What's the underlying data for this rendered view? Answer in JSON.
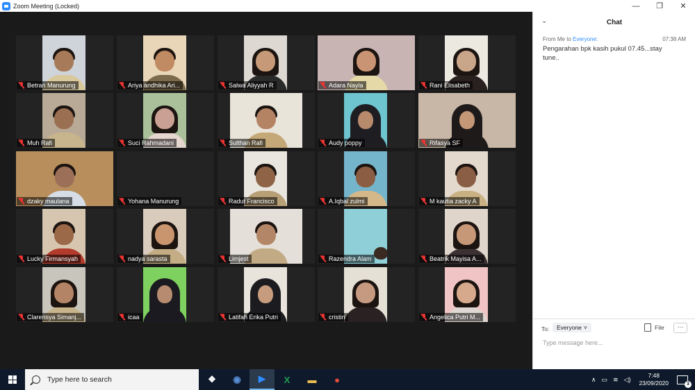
{
  "window": {
    "title": "Zoom Meeting (Locked)",
    "minimize": "—",
    "restore": "❐",
    "close": "✕"
  },
  "participants": [
    {
      "name": "Betran Manurung",
      "muted": true,
      "bg": "#cfd4da",
      "skin": "#a77b5a",
      "shirt": "#d8c89c",
      "style": "boy"
    },
    {
      "name": "Ariya andhika Ari...",
      "muted": true,
      "bg": "#e9d6b8",
      "skin": "#c08a62",
      "shirt": "#7c6b4a",
      "style": "boy"
    },
    {
      "name": "Salwa Aliyyah R",
      "muted": true,
      "bg": "#ddd8d2",
      "skin": "#c69a78",
      "shirt": "#2a2a2a",
      "style": "girl"
    },
    {
      "name": "Adara Nayla",
      "muted": true,
      "bg": "#c7b4b3",
      "skin": "#c89474",
      "shirt": "#e6d9a8",
      "style": "girl"
    },
    {
      "name": "Rani Elisabeth",
      "muted": true,
      "bg": "#ece9e0",
      "skin": "#c9a58a",
      "shirt": "#2a2020",
      "style": "girl"
    },
    {
      "name": "Muh Rafi",
      "muted": true,
      "bg": "#b9aa97",
      "skin": "#9a6f52",
      "shirt": "#c8b58e",
      "style": "boy"
    },
    {
      "name": "Suci Rahmadani",
      "muted": true,
      "bg": "#a9c09a",
      "skin": "#c9a093",
      "shirt": "#e6d6d0",
      "style": "girl"
    },
    {
      "name": "Sulthan Rafi",
      "muted": true,
      "bg": "#e9e4da",
      "skin": "#b48364",
      "shirt": "#c4a878",
      "style": "boy"
    },
    {
      "name": "Audy poppy",
      "muted": true,
      "bg": "#6ec4cf",
      "skin": "#b88a6c",
      "shirt": "#1e1e22",
      "style": "hijab"
    },
    {
      "name": "Rifasya SF",
      "muted": true,
      "bg": "#c8b7a6",
      "skin": "#c49877",
      "shirt": "#1e1a1a",
      "style": "hijab"
    },
    {
      "name": "dzaky maulana",
      "muted": true,
      "bg": "#b88f5c",
      "skin": "#9c7058",
      "shirt": "#d6dde6",
      "style": "boy"
    },
    {
      "name": "Yohana Manurung",
      "muted": true,
      "bg": "#232323",
      "skin": "#232323",
      "shirt": "#232323",
      "style": "none"
    },
    {
      "name": "Radut Francisco",
      "muted": true,
      "bg": "#e9e6df",
      "skin": "#8e6346",
      "shirt": "#b79f76",
      "style": "boy"
    },
    {
      "name": "A.Iqbal zulmi",
      "muted": true,
      "bg": "#74b5cc",
      "skin": "#8b5e44",
      "shirt": "#d4b889",
      "style": "boy"
    },
    {
      "name": "M kautia zacky A",
      "muted": true,
      "bg": "#e3dacd",
      "skin": "#8a5e44",
      "shirt": "#c9b183",
      "style": "boy"
    },
    {
      "name": "Lucky Firmansyah",
      "muted": true,
      "bg": "#d6c6b0",
      "skin": "#9b6848",
      "shirt": "#b23b2b",
      "style": "boy"
    },
    {
      "name": "nadya sarasta",
      "muted": true,
      "bg": "#d9ccbc",
      "skin": "#c9956f",
      "shirt": "#c4ad84",
      "style": "girl"
    },
    {
      "name": "Limjest",
      "muted": true,
      "bg": "#e4dfd8",
      "skin": "#b38667",
      "shirt": "#c2ab84",
      "style": "boy"
    },
    {
      "name": "Razendra Alam",
      "muted": true,
      "bg": "#8fd0d8",
      "skin": "#3a2a22",
      "shirt": "#6fb8c0",
      "style": "none"
    },
    {
      "name": "Beatrik Mayisa A...",
      "muted": true,
      "bg": "#dfd5cb",
      "skin": "#c69878",
      "shirt": "#3c3234",
      "style": "girl"
    },
    {
      "name": "Clarensya Simanj...",
      "muted": true,
      "bg": "#c8c6bc",
      "skin": "#b48466",
      "shirt": "#c8b48c",
      "style": "girl"
    },
    {
      "name": "icaa",
      "muted": true,
      "bg": "#7fd15f",
      "skin": "#b68b6f",
      "shirt": "#1a1a20",
      "style": "hijab"
    },
    {
      "name": "Latifah Erika Putri",
      "muted": true,
      "bg": "#e9e4db",
      "skin": "#c69b7e",
      "shirt": "#1b1b20",
      "style": "hijab"
    },
    {
      "name": "cristin",
      "muted": true,
      "bg": "#e5e0d6",
      "skin": "#c59a80",
      "shirt": "#2a2222",
      "style": "girl"
    },
    {
      "name": "Angelica Putri M...",
      "muted": true,
      "bg": "#f0c4c4",
      "skin": "#d6a98c",
      "shirt": "#ded7d2",
      "style": "girl"
    }
  ],
  "chat": {
    "title": "Chat",
    "collapse_icon": "⌄",
    "from_label": "From Me to ",
    "to_target": "Everyone",
    "to_suffix": ":",
    "time": "07:38 AM",
    "message": "Pengarahan bpk kasih pukul 07.45...stay tune..",
    "to_label": "To:",
    "recipient": "Everyone",
    "recipient_chevron": "˅",
    "file_label": "File",
    "more_label": "···",
    "input_placeholder": "Type message here..."
  },
  "taskbar": {
    "search_placeholder": "Type here to search",
    "apps": [
      {
        "icon": "task-view-icon",
        "glyph": "❖",
        "color": "#ffffff",
        "active": false
      },
      {
        "icon": "browser-icon",
        "glyph": "◉",
        "color": "#5a8fd8",
        "active": false
      },
      {
        "icon": "zoom-icon",
        "glyph": "▶",
        "color": "#2D8CFF",
        "active": true
      },
      {
        "icon": "excel-icon",
        "glyph": "X",
        "color": "#1f9d55",
        "active": false
      },
      {
        "icon": "file-explorer-icon",
        "glyph": "▬",
        "color": "#f2c14e",
        "active": false
      },
      {
        "icon": "chrome-icon",
        "glyph": "●",
        "color": "#e74c3c",
        "active": false
      }
    ],
    "tray_chevron": "∧",
    "tray_battery": "▭",
    "tray_wifi": "≋",
    "tray_volume": "◁)",
    "time": "7:48",
    "date": "23/09/2020",
    "notification_count": "3"
  }
}
